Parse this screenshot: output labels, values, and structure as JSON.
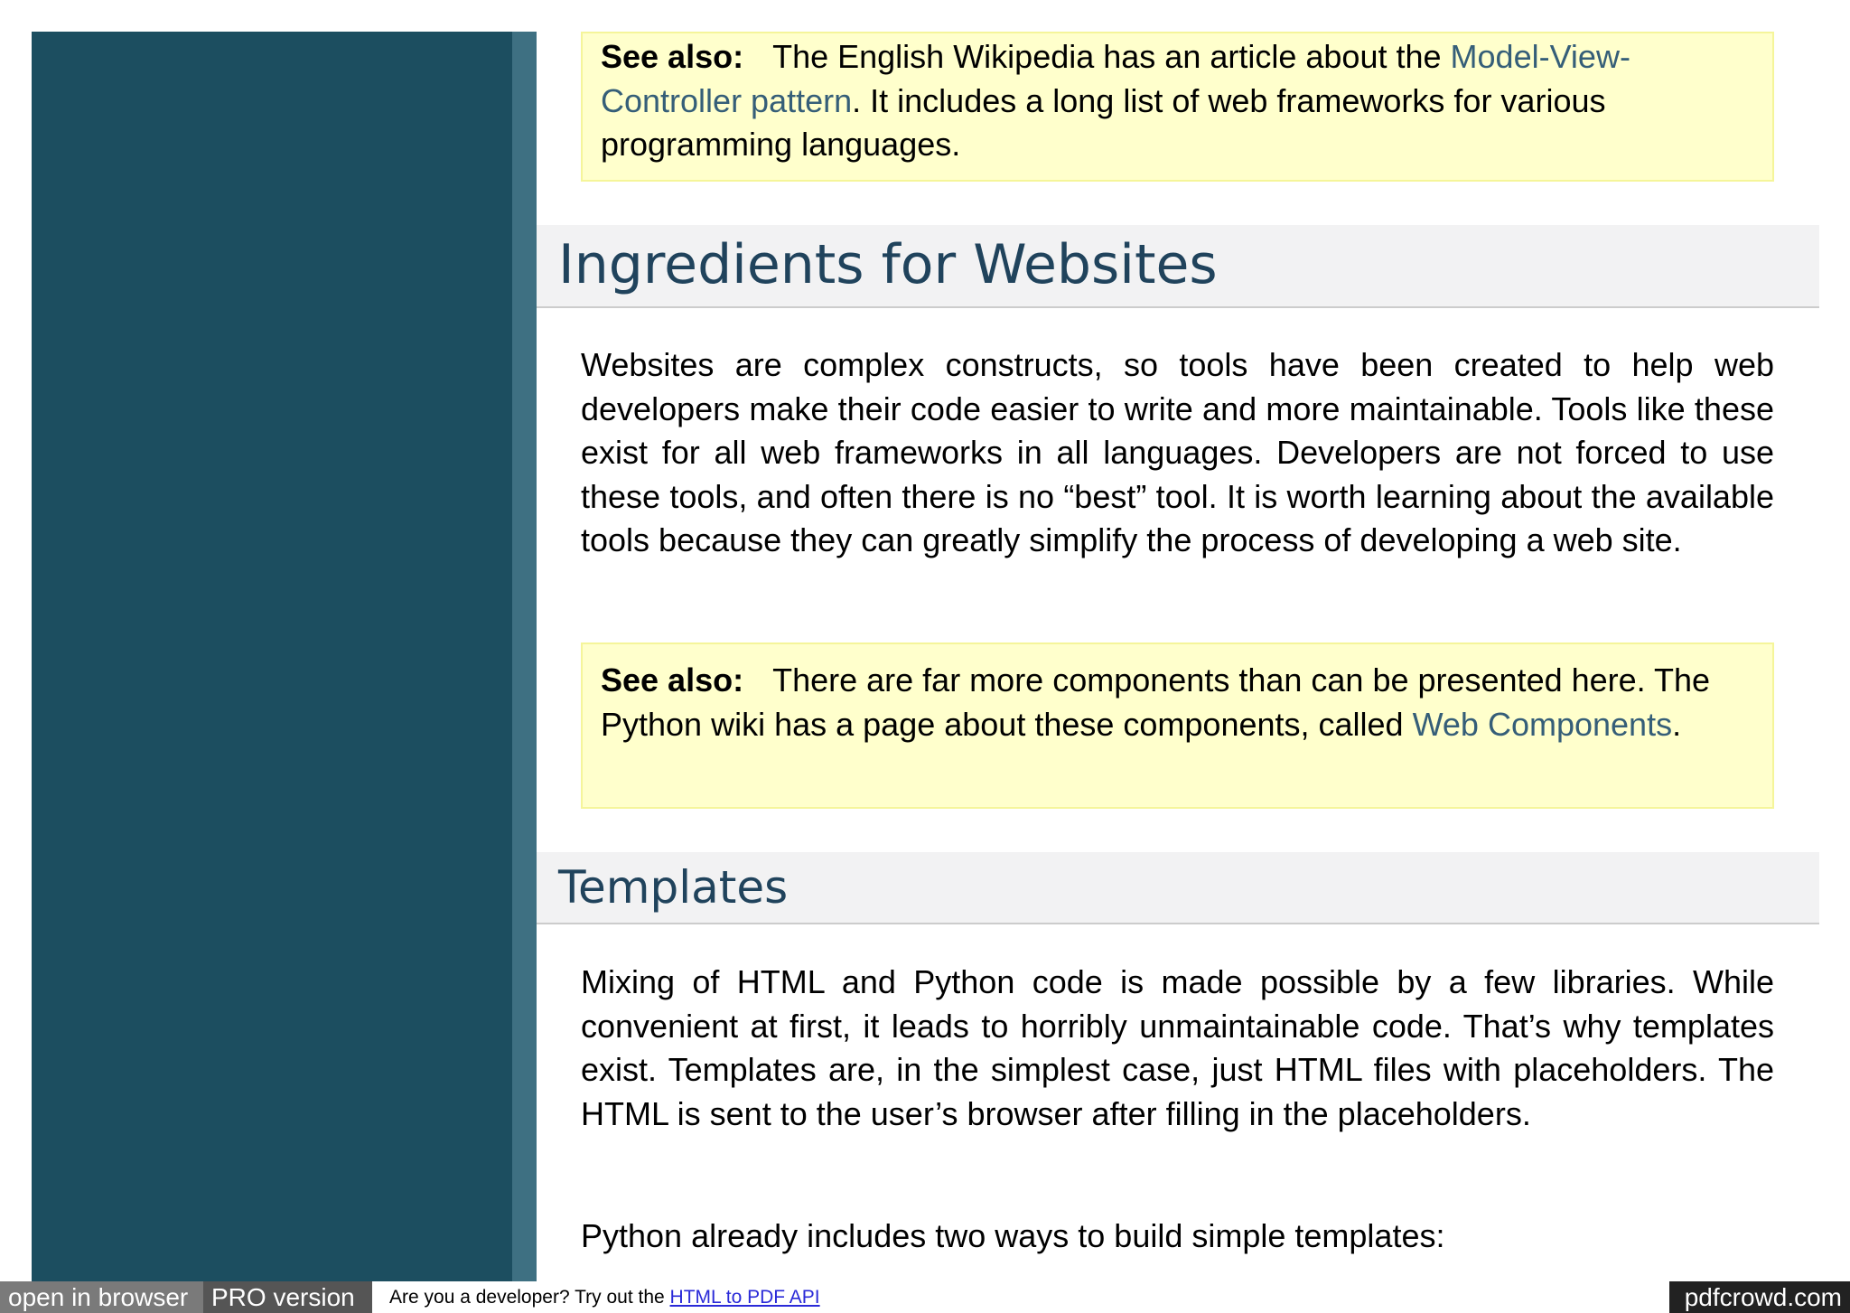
{
  "note1": {
    "label": "See also:",
    "text_before": "The English Wikipedia has an article about the ",
    "link": "Model-View-Controller pattern",
    "text_after": ". It includes a long list of web frameworks for various programming languages."
  },
  "section1": {
    "heading": "Ingredients for Websites",
    "paragraph": "Websites are complex constructs, so tools have been created to help web developers make their code easier to write and more maintainable. Tools like these exist for all web frameworks in all languages. Developers are not forced to use these tools, and often there is no “best” tool. It is worth learning about the available tools because they can greatly simplify the process of developing a web site."
  },
  "note2": {
    "label": "See also:",
    "text_before": "There are far more components than can be presented here. The Python wiki has a page about these components, called ",
    "link": "Web Components",
    "text_after": "."
  },
  "section2": {
    "heading": "Templates",
    "paragraph1": "Mixing of HTML and Python code is made possible by a few libraries. While convenient at first, it leads to horribly unmaintainable code. That’s why templates exist. Templates are, in the simplest case, just HTML files with placeholders. The HTML is sent to the user’s browser after filling in the placeholders.",
    "paragraph2": "Python already includes two ways to build simple templates:"
  },
  "footer": {
    "open_in_browser": "open in browser",
    "pro_version": "PRO version",
    "dev_text": "Are you a developer? Try out the ",
    "api_link": "HTML to PDF API",
    "brand": "pdfcrowd.com"
  }
}
